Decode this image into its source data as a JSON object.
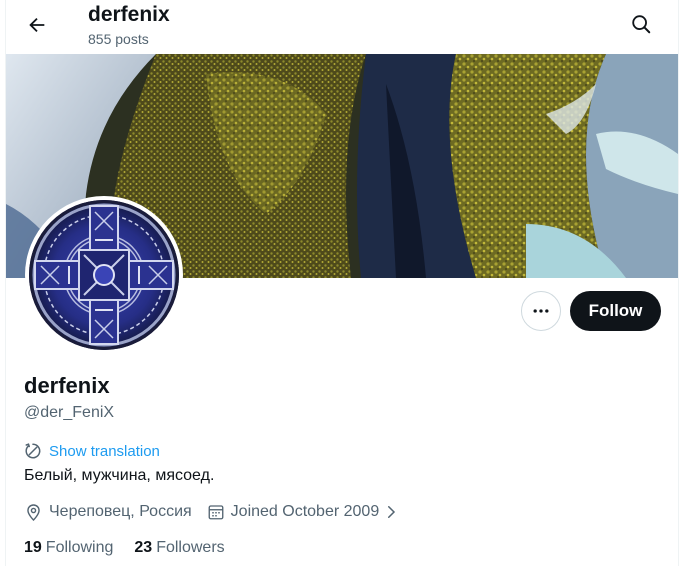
{
  "header": {
    "title": "derfenix",
    "post_count": "855 posts"
  },
  "profile": {
    "display_name": "derfenix",
    "handle": "@der_FeniX",
    "translate_label": "Show translation",
    "bio": "Белый, мужчина, мясоед.",
    "location": "Череповец, Россия",
    "joined": "Joined October 2009",
    "following_count": "19",
    "following_label": "Following",
    "followers_count": "23",
    "followers_label": "Followers"
  },
  "actions": {
    "follow_label": "Follow"
  },
  "icons": {
    "back": "arrow-left-icon",
    "search": "search-icon",
    "more": "more-dots-icon",
    "translate": "translate-icon",
    "location": "location-pin-icon",
    "calendar": "calendar-icon",
    "chevron": "chevron-right-icon"
  },
  "colors": {
    "text_primary": "#0f1419",
    "text_secondary": "#536471",
    "link": "#1d9bf0",
    "follow_bg": "#0f1419",
    "border": "#cfd9de"
  }
}
